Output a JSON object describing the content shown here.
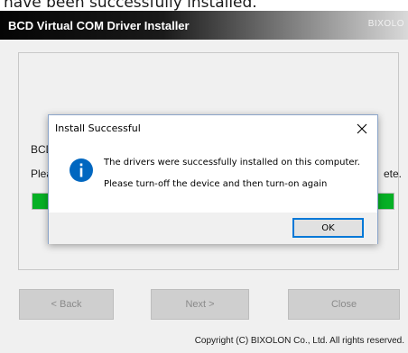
{
  "top_caption": "have been successfully installed.",
  "window": {
    "title": "BCD Virtual COM Driver Installer",
    "brand": "BIXOLO"
  },
  "status": {
    "line1_prefix": "BCD",
    "line2_prefix": "Plea",
    "line2_suffix": "ete.",
    "progress_fraction": 1.0
  },
  "buttons": {
    "back": "< Back",
    "next": "Next >",
    "close": "Close"
  },
  "copyright": "Copyright (C) BIXOLON Co., Ltd. All rights reserved.",
  "dialog": {
    "title": "Install Successful",
    "close_glyph": "✕",
    "message_line1": "The drivers were successfully installed on this computer.",
    "message_line2": "Please turn-off the device and then turn-on again",
    "ok_label": "OK",
    "icon": "info-icon"
  },
  "colors": {
    "progress": "#06b025",
    "info_icon": "#0067c0",
    "ok_border": "#0078d7"
  }
}
